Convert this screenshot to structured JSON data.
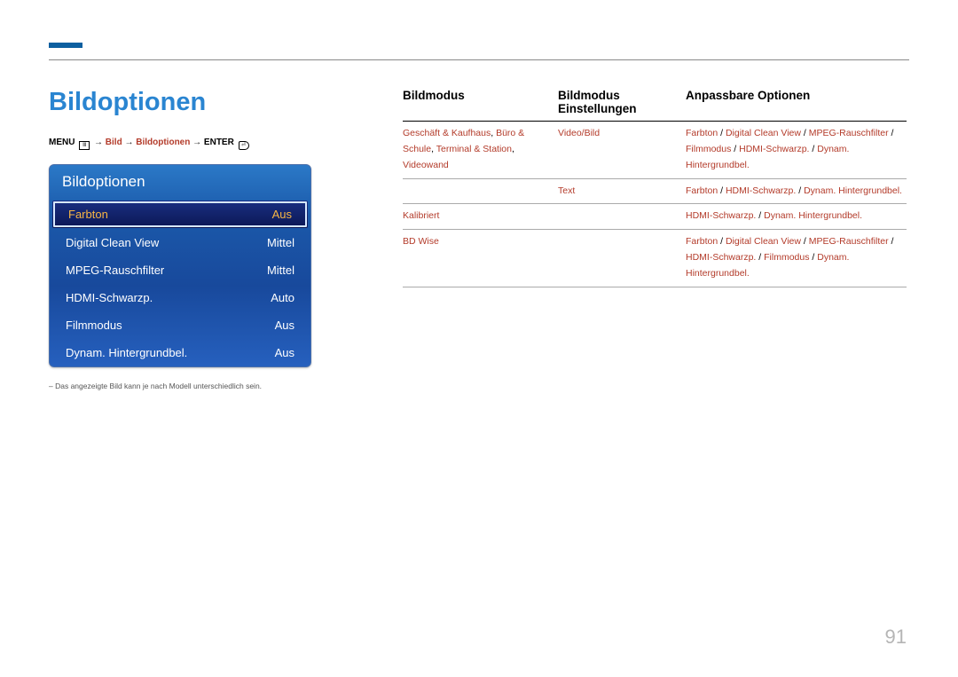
{
  "page_title": "Bildoptionen",
  "breadcrumb": {
    "menu": "MENU",
    "arrow": "→",
    "p1": "Bild",
    "p2": "Bildoptionen",
    "enter": "ENTER"
  },
  "osd": {
    "title": "Bildoptionen",
    "rows": [
      {
        "label": "Farbton",
        "value": "Aus",
        "highlight": true
      },
      {
        "label": "Digital Clean View",
        "value": "Mittel",
        "highlight": false
      },
      {
        "label": "MPEG-Rauschfilter",
        "value": "Mittel",
        "highlight": false
      },
      {
        "label": "HDMI-Schwarzp.",
        "value": "Auto",
        "highlight": false
      },
      {
        "label": "Filmmodus",
        "value": "Aus",
        "highlight": false
      },
      {
        "label": "Dynam. Hintergrundbel.",
        "value": "Aus",
        "highlight": false
      }
    ]
  },
  "footnote": "Das angezeigte Bild kann je nach Modell unterschiedlich sein.",
  "table": {
    "headers": {
      "c1": "Bildmodus",
      "c2": "Bildmodus Einstellungen",
      "c3": "Anpassbare Optionen"
    },
    "rows": [
      {
        "c1_parts": [
          "Geschäft & Kaufhaus",
          ", ",
          "Büro & Schule",
          ", ",
          "Terminal & Station",
          ", ",
          "Videowand"
        ],
        "sub": [
          {
            "c2": "Video/Bild",
            "c3_parts": [
              "Farbton",
              " / ",
              "Digital Clean View",
              " / ",
              "MPEG-Rauschfilter",
              " / ",
              "Filmmodus",
              " / ",
              "HDMI-Schwarzp.",
              " / ",
              "Dynam. Hintergrundbel."
            ]
          },
          {
            "c2": "Text",
            "c3_parts": [
              "Farbton",
              " / ",
              "HDMI-Schwarzp.",
              " / ",
              "Dynam. Hintergrundbel."
            ]
          }
        ]
      },
      {
        "c1_parts": [
          "Kalibriert"
        ],
        "sub": [
          {
            "c2": "",
            "c3_parts": [
              "HDMI-Schwarzp.",
              " / ",
              "Dynam. Hintergrundbel."
            ]
          }
        ]
      },
      {
        "c1_parts": [
          "BD Wise"
        ],
        "sub": [
          {
            "c2": "",
            "c3_parts": [
              "Farbton",
              " / ",
              "Digital Clean View",
              " / ",
              "MPEG-Rauschfilter",
              " / ",
              "HDMI-Schwarzp.",
              " / ",
              "Filmmodus",
              " / ",
              "Dynam. Hintergrundbel."
            ]
          }
        ]
      }
    ]
  },
  "pagenum": "91"
}
